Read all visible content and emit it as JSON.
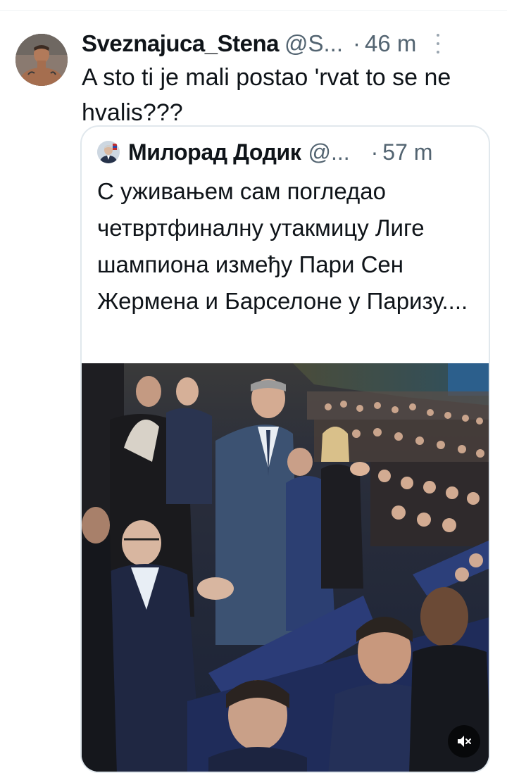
{
  "tweet": {
    "display_name": "Sveznajuca_Stena",
    "handle": "@S...",
    "time": "46 m",
    "separator": "·",
    "text": "A sto ti je mali postao 'rvat to se ne hvalis???",
    "avatar_icon": "user-avatar-photo",
    "more_icon": "more-vertical-icon"
  },
  "quoted_tweet": {
    "display_name": "Милорад Додик",
    "handle": "@...",
    "time": "57 m",
    "separator": "·",
    "text": "С уживањем сам погледао четвртфиналну утакмицу Лиге шампиона између Пари Сен Жермена и Барселоне у Паризу....",
    "avatar_icon": "user-avatar-photo",
    "media": {
      "type": "video",
      "mute_icon": "speaker-muted-icon"
    }
  },
  "colors": {
    "text_primary": "#0f1419",
    "text_secondary": "#536471",
    "card_border": "#e1e8ed"
  }
}
